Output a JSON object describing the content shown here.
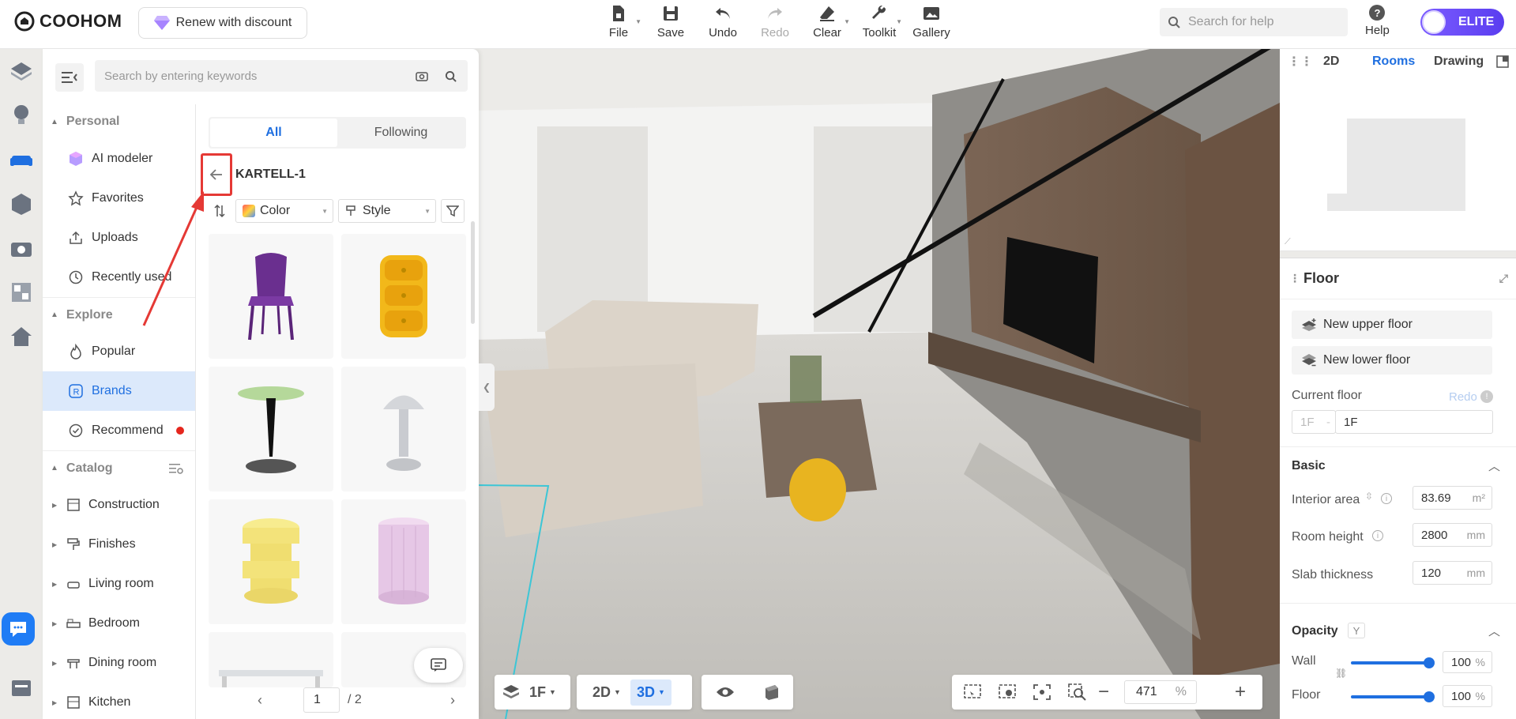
{
  "app": {
    "logo": "COOHOM",
    "renew": "Renew with discount",
    "elite": "ELITE",
    "help": "Help",
    "search_help_placeholder": "Search for help"
  },
  "toolbar": {
    "file": "File",
    "save": "Save",
    "undo": "Undo",
    "redo": "Redo",
    "clear": "Clear",
    "toolkit": "Toolkit",
    "gallery": "Gallery"
  },
  "panel": {
    "search_placeholder": "Search by entering keywords",
    "sections": {
      "personal": "Personal",
      "explore": "Explore",
      "catalog": "Catalog"
    },
    "personal": [
      "AI modeler",
      "Favorites",
      "Uploads",
      "Recently used"
    ],
    "explore": [
      "Popular",
      "Brands",
      "Recommend"
    ],
    "catalog": [
      "Construction",
      "Finishes",
      "Living room",
      "Bedroom",
      "Dining room",
      "Kitchen"
    ],
    "tabs": [
      "All",
      "Following"
    ],
    "brand": "KARTELL-1",
    "filters": {
      "color": "Color",
      "style": "Style"
    },
    "page": "1",
    "pages": "/ 2"
  },
  "minimap": {
    "tabs": [
      "2D",
      "Rooms",
      "Drawing"
    ],
    "active": "Rooms"
  },
  "props": {
    "title": "Floor",
    "new_upper": "New upper floor",
    "new_lower": "New lower floor",
    "current_floor": "Current floor",
    "redo": "Redo",
    "floor_dis": "1F",
    "floor_val": "1F",
    "basic": "Basic",
    "interior_area": "Interior area",
    "interior_area_val": "83.69",
    "interior_area_unit": "m²",
    "room_height": "Room height",
    "room_height_val": "2800",
    "room_height_unit": "mm",
    "slab": "Slab thickness",
    "slab_val": "120",
    "slab_unit": "mm",
    "opacity": "Opacity",
    "opacity_key": "Y",
    "wall": "Wall",
    "wall_val": "100",
    "floor": "Floor",
    "floor_val2": "100",
    "pct": "%"
  },
  "bottom": {
    "floor": "1F",
    "view2d": "2D",
    "view3d": "3D",
    "zoom": "471",
    "pct": "%"
  },
  "colors": {
    "accent": "#1f6fe0",
    "annotation": "#e53935",
    "elite": "#6a4cf5"
  }
}
